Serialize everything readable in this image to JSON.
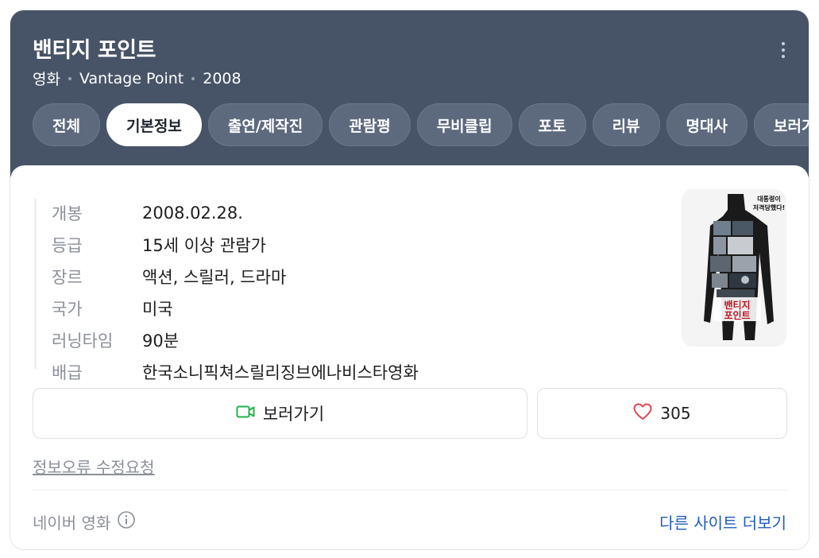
{
  "header": {
    "title": "밴티지 포인트",
    "meta": {
      "category": "영화",
      "original_title": "Vantage Point",
      "year": "2008"
    },
    "more_icon": "more-vertical-icon"
  },
  "tabs": [
    {
      "label": "전체",
      "active": false
    },
    {
      "label": "기본정보",
      "active": true
    },
    {
      "label": "출연/제작진",
      "active": false
    },
    {
      "label": "관람평",
      "active": false
    },
    {
      "label": "무비클립",
      "active": false
    },
    {
      "label": "포토",
      "active": false
    },
    {
      "label": "리뷰",
      "active": false
    },
    {
      "label": "명대사",
      "active": false
    },
    {
      "label": "보러가기",
      "active": false
    }
  ],
  "info": [
    {
      "key": "개봉",
      "value": "2008.02.28."
    },
    {
      "key": "등급",
      "value": "15세 이상 관람가"
    },
    {
      "key": "장르",
      "value": "액션, 스릴러, 드라마"
    },
    {
      "key": "국가",
      "value": "미국"
    },
    {
      "key": "러닝타임",
      "value": "90분"
    },
    {
      "key": "배급",
      "value": "한국소니픽쳐스릴리징브에나비스타영화"
    }
  ],
  "poster": {
    "title_line1": "밴티지",
    "title_line2": "포인트",
    "tagline_line1": "대통령이",
    "tagline_line2": "저격당했다!"
  },
  "actions": {
    "watch_label": "보러가기",
    "watch_icon": "video-icon",
    "like_count": "305",
    "like_icon": "heart-icon"
  },
  "footer": {
    "report_label": "정보오류 수정요청",
    "source_label": "네이버 영화",
    "more_sites_label": "다른 사이트 더보기"
  },
  "colors": {
    "header_bg": "#475467",
    "tab_bg": "#5d6a7e",
    "link_blue": "#1f5bbf",
    "watch_icon_green": "#22b14c",
    "heart_red": "#e0454f"
  }
}
